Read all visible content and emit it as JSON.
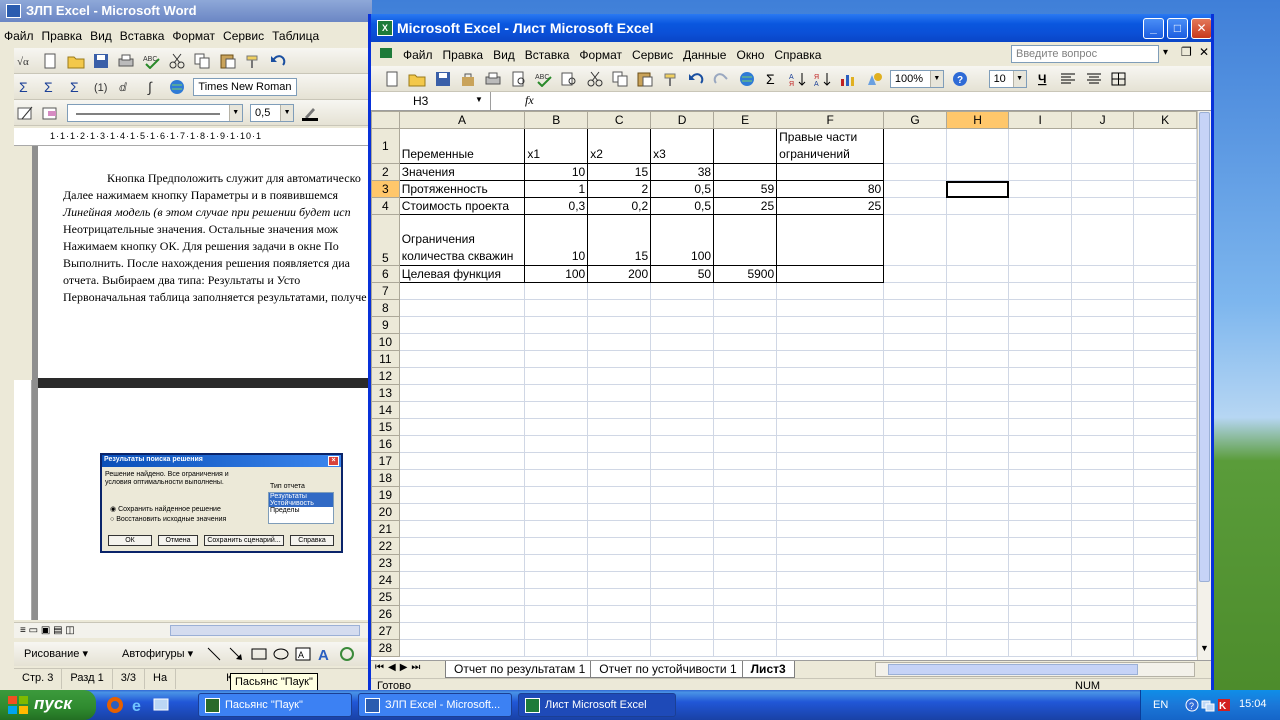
{
  "word": {
    "title": "ЗЛП Excel - Microsoft Word",
    "menu": [
      "Файл",
      "Правка",
      "Вид",
      "Вставка",
      "Формат",
      "Сервис",
      "Таблица"
    ],
    "font_name": "Times New Roman",
    "line_width": "0,5",
    "ruler_text": "1·1·1·2·1·3·1·4·1·5·1·6·1·7·1·8·1·9·1·10·1",
    "doc_lines": [
      "Кнопка Предположить служит для автоматическо",
      "Далее нажимаем кнопку Параметры и в появившемся",
      "Линейная модель (в этом случае при решении будет исп",
      "Неотрицательные значения. Остальные значения мож",
      "Нажимаем кнопку ОК. Для решения задачи в окне По",
      "Выполнить. После нахождения решения появляется диа",
      "отчета. Выбираем два типа: Результаты и Усто",
      "Первоначальная таблица заполняется результатами, получе"
    ],
    "dialog": {
      "title": "Результаты поиска решения",
      "message": "Решение найдено. Все ограничения и условия оптимальности выполнены.",
      "report_type_label": "Тип отчета",
      "report_types": [
        "Результаты",
        "Устойчивость",
        "Пределы"
      ],
      "option_keep": "Сохранить найденное решение",
      "option_restore": "Восстановить исходные значения",
      "buttons": [
        "ОК",
        "Отмена",
        "Сохранить сценарий...",
        "Справка"
      ]
    },
    "draw_toolbar": {
      "drawing": "Рисование ▾",
      "autoshapes": "Автофигуры ▾"
    },
    "status": {
      "page": "Стр. 3",
      "section": "Разд 1",
      "pages": "3/3",
      "at": "На",
      "col": "Кол 1"
    },
    "tooltip": "Пасьянс \"Паук\""
  },
  "excel": {
    "title": "Microsoft Excel - Лист Microsoft Excel",
    "menu": [
      "Файл",
      "Правка",
      "Вид",
      "Вставка",
      "Формат",
      "Сервис",
      "Данные",
      "Окно",
      "Справка"
    ],
    "ask_placeholder": "Введите вопрос",
    "zoom": "100%",
    "font_size": "10",
    "name_box": "H3",
    "fx_label": "fx",
    "columns": [
      "A",
      "B",
      "C",
      "D",
      "E",
      "F",
      "G",
      "H",
      "I",
      "J",
      "K"
    ],
    "selected_column": "H",
    "selected_row": "3",
    "rows": [
      {
        "n": "1",
        "cells": [
          "Переменные",
          "x1",
          "x2",
          "x3",
          "",
          "Правые части ограничений"
        ]
      },
      {
        "n": "2",
        "cells": [
          "Значения",
          "10",
          "15",
          "38",
          "",
          ""
        ]
      },
      {
        "n": "3",
        "cells": [
          "Протяженность",
          "1",
          "2",
          "0,5",
          "59",
          "80"
        ]
      },
      {
        "n": "4",
        "cells": [
          "Стоимость проекта",
          "0,3",
          "0,2",
          "0,5",
          "25",
          "25"
        ]
      },
      {
        "n": "5",
        "cells": [
          "Ограничения количества скважин",
          "10",
          "15",
          "100",
          "",
          ""
        ]
      },
      {
        "n": "6",
        "cells": [
          "Целевая функция",
          "100",
          "200",
          "50",
          "5900",
          ""
        ]
      }
    ],
    "empty_rows": [
      "7",
      "8",
      "9",
      "10",
      "11",
      "12",
      "13",
      "14",
      "15",
      "16",
      "17",
      "18",
      "19",
      "20",
      "21",
      "22",
      "23",
      "24",
      "25",
      "26",
      "27",
      "28"
    ],
    "sheet_tabs": [
      "Отчет по результатам 1",
      "Отчет по устойчивости 1",
      "Лист3"
    ],
    "active_tab": "Лист3",
    "status": {
      "ready": "Готово",
      "num": "NUM"
    }
  },
  "taskbar": {
    "start": "пуск",
    "tasks": [
      "Пасьянс \"Паук\"",
      "ЗЛП Excel - Microsoft...",
      "Лист Microsoft Excel"
    ],
    "lang": "EN",
    "time": "15:04"
  },
  "colors": {
    "title_blue": "#0a57df",
    "selected_header": "#ffc76b",
    "taskbar": "#2157d7",
    "start_green": "#3c9a3c"
  }
}
